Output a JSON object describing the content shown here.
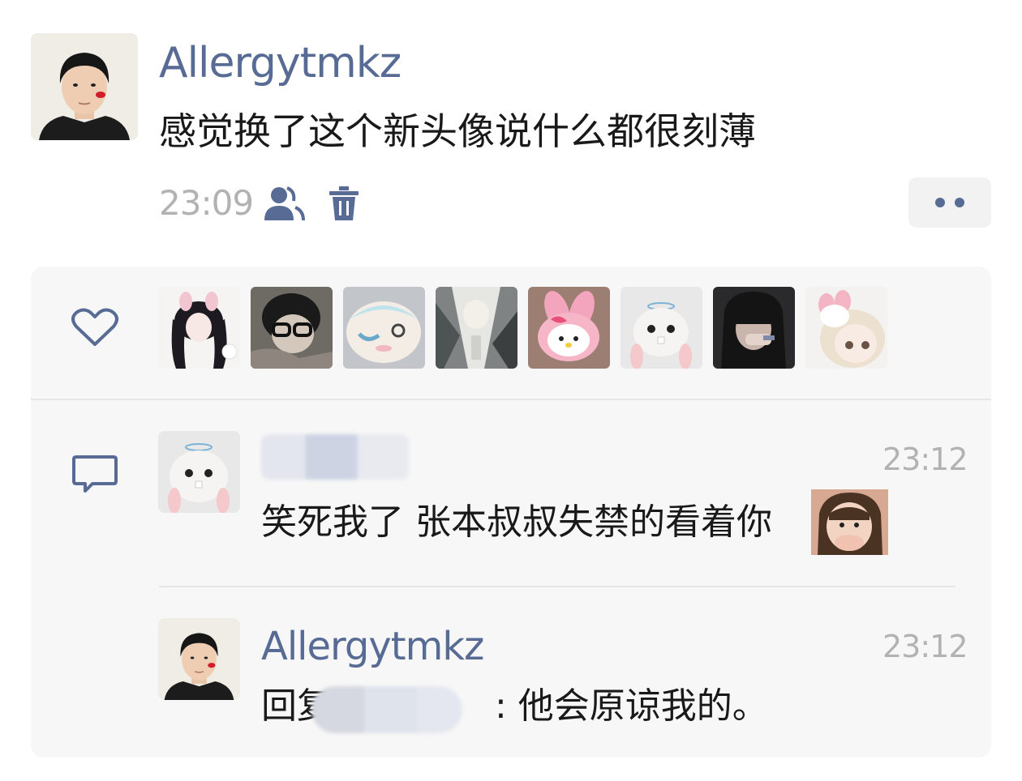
{
  "post": {
    "author": "Allergytmkz",
    "text": "感觉换了这个新头像说什么都很刻薄",
    "time": "23:09",
    "icons": {
      "visibility": "friends-visibility-icon",
      "delete": "trash-icon",
      "more": "more-dots-icon"
    }
  },
  "likes": {
    "icon": "heart-icon",
    "count_shown": 8
  },
  "comments": [
    {
      "author_hidden": true,
      "time": "23:12",
      "text": "笑死我了 张本叔叔失禁的看着你",
      "has_sticker": true
    },
    {
      "author": "Allergytmkz",
      "time": "23:12",
      "reply_prefix": "回复",
      "reply_suffix": ": 他会原谅我的。"
    }
  ],
  "colors": {
    "accent": "#576b95",
    "text": "#191919",
    "muted": "#b2b2b2",
    "panel": "#f7f7f7"
  }
}
